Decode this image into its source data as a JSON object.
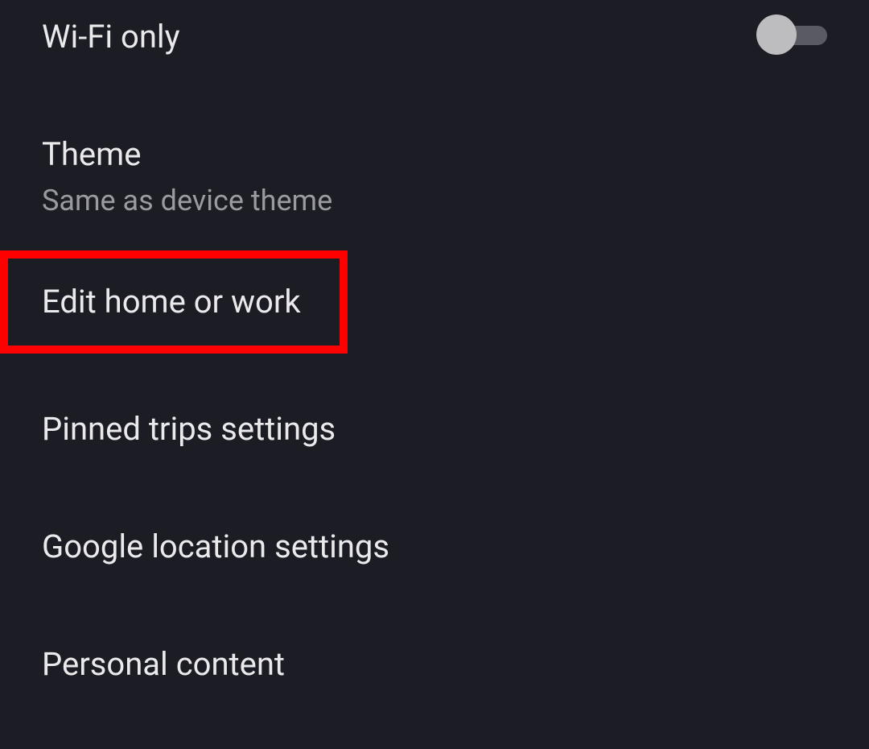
{
  "settings": {
    "wifi_only": {
      "label": "Wi-Fi only",
      "toggle_on": false
    },
    "theme": {
      "label": "Theme",
      "value": "Same as device theme"
    },
    "edit_home_work": {
      "label": "Edit home or work"
    },
    "pinned_trips": {
      "label": "Pinned trips settings"
    },
    "google_location": {
      "label": "Google location settings"
    },
    "personal_content": {
      "label": "Personal content"
    }
  }
}
